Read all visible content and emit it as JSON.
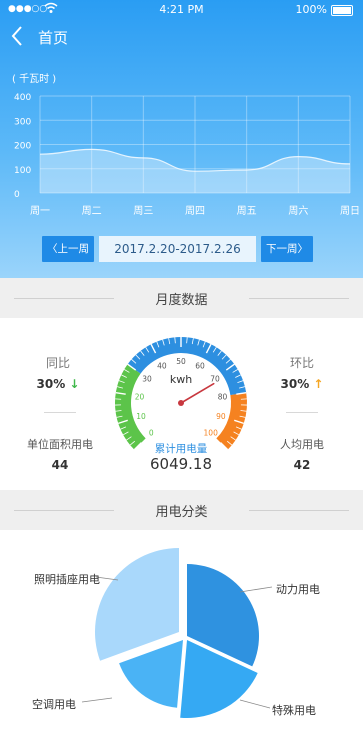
{
  "status_bar": {
    "signal": "●●●○○",
    "time": "4:21 PM",
    "battery": "100%"
  },
  "nav": {
    "title": "首页"
  },
  "weekly_chart": {
    "unit_label": "( 千瓦时 )",
    "y_ticks": [
      "400",
      "300",
      "200",
      "100",
      "0"
    ],
    "chart_data": {
      "type": "area",
      "categories": [
        "周一",
        "周二",
        "周三",
        "周四",
        "周五",
        "周六",
        "周日"
      ],
      "values": [
        160,
        180,
        145,
        90,
        95,
        150,
        120
      ],
      "ylim": [
        0,
        400
      ],
      "grid": true
    }
  },
  "week_nav": {
    "prev_label": "上一周",
    "range": "2017.2.20-2017.2.26",
    "next_label": "下一周"
  },
  "monthly": {
    "section_title": "月度数据",
    "yoy": {
      "label": "同比",
      "value": "30%",
      "arrow": "↓"
    },
    "mom": {
      "label": "环比",
      "value": "30%",
      "arrow": "↑"
    },
    "per_area": {
      "label": "单位面积用电",
      "value": "44"
    },
    "per_capita": {
      "label": "人均用电",
      "value": "42"
    },
    "gauge": {
      "unit": "kwh",
      "caption": "累计用电量",
      "total": "6049.18",
      "ticks": [
        "0",
        "10",
        "20",
        "30",
        "40",
        "50",
        "60",
        "70",
        "80",
        "90",
        "100"
      ],
      "needle_value": 72,
      "colors": {
        "low": "#5cc44a",
        "mid": "#2d8fe0",
        "high": "#f58220"
      }
    }
  },
  "categories": {
    "section_title": "用电分类",
    "slices": [
      {
        "name": "照明插座用电",
        "color": "#a9d8fb"
      },
      {
        "name": "动力用电",
        "color": "#2f92e0"
      },
      {
        "name": "特殊用电",
        "color": "#35a9f3"
      },
      {
        "name": "空调用电",
        "color": "#4ab3f5"
      }
    ]
  }
}
